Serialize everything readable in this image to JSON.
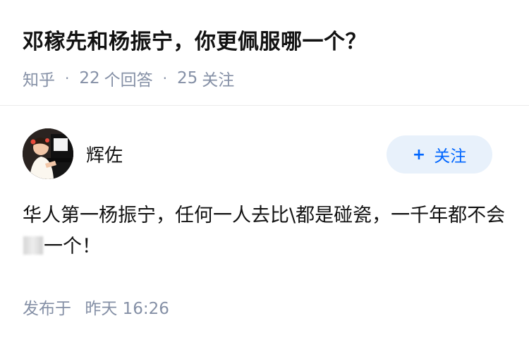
{
  "question": {
    "title": "邓稼先和杨振宁，你更佩服哪一个？",
    "source": "知乎",
    "separator": "·",
    "answer_count": "22",
    "answer_label": "个回答",
    "follower_count": "25",
    "follower_label": "关注"
  },
  "author": {
    "name": "辉佐",
    "follow_plus": "+",
    "follow_label": "关注"
  },
  "answer": {
    "text_part1": "华人第一杨振宁，任何一人去比\\都是碰瓷，一千年都不会",
    "text_part2": "一个！"
  },
  "post": {
    "label": "发布于",
    "time": "昨天 16:26"
  },
  "colors": {
    "accent": "#0066ff",
    "follow_bg": "#e8f1fb",
    "meta_text": "#8590a6"
  }
}
